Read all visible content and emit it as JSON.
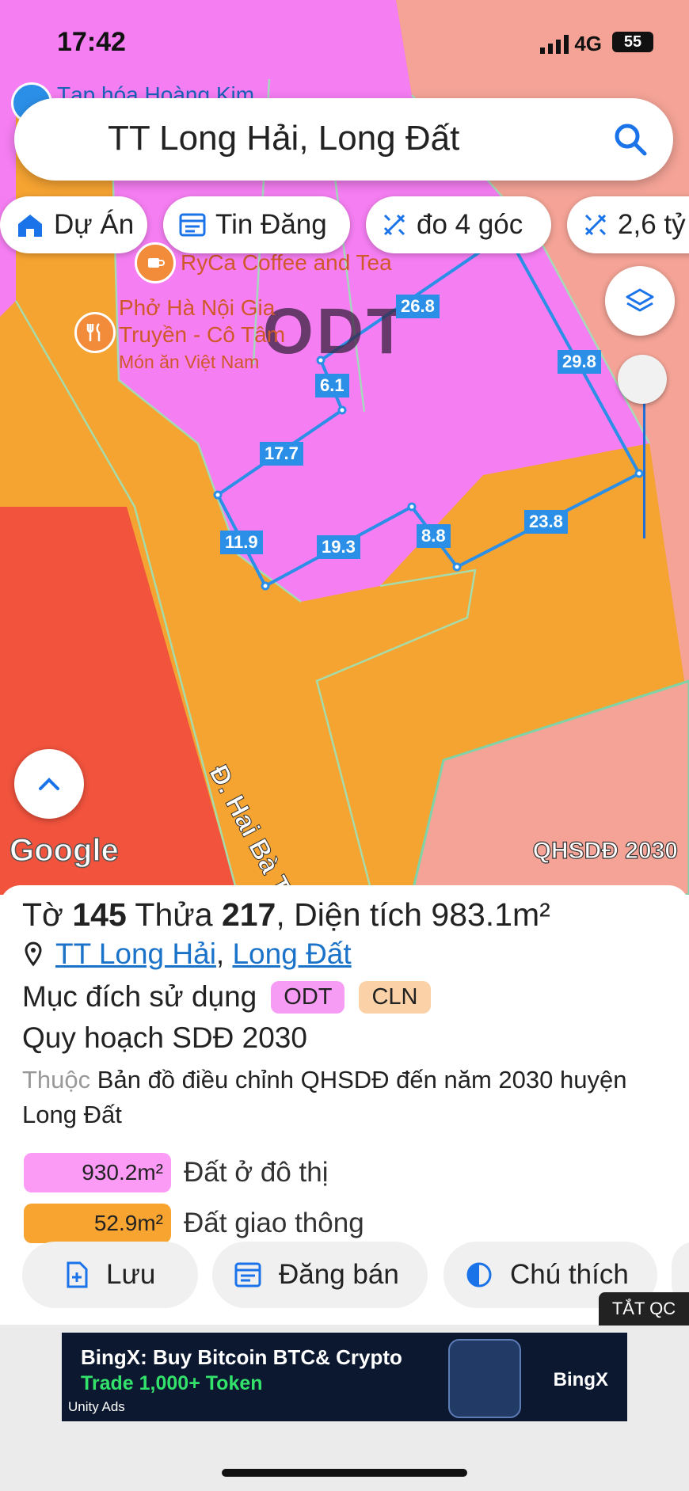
{
  "status": {
    "time": "17:42",
    "network": "4G",
    "battery": "55"
  },
  "search": {
    "query": "TT Long Hải, Long Đất"
  },
  "chips": [
    "Dự Án",
    "Tin Đăng",
    "đo 4 góc",
    "2,6 tỷ"
  ],
  "map": {
    "poi": [
      {
        "name": "Tạp hóa Hoàng Kim"
      },
      {
        "name": "RyCa Coffee and Tea"
      },
      {
        "name": "Phở Hà Nội Gia Truyền - Cô Tâm",
        "line1": "Phở Hà Nội Gia",
        "line2": "Truyền - Cô Tâm",
        "category": "Món ăn Việt Nam"
      }
    ],
    "zone_label": "ODT",
    "road_label": "Đ. Hai Bà Trưng",
    "edge_lengths": [
      "26.8",
      "29.8",
      "6.1",
      "17.7",
      "11.9",
      "19.3",
      "8.8",
      "23.8"
    ],
    "attribution": "Google",
    "layer_name": "QHSDĐ 2030"
  },
  "parcel": {
    "to_label": "Tờ",
    "to": "145",
    "thua_label": "Thửa",
    "thua": "217",
    "area_label": "Diện tích",
    "area": "983.1m²",
    "location_town": "TT Long Hải",
    "location_district": "Long Đất",
    "purpose_label": "Mục đích sử dụng",
    "purposes": [
      {
        "code": "ODT",
        "color": "#f79cf4"
      },
      {
        "code": "CLN",
        "color": "#fbd2a8"
      }
    ],
    "plan_title": "Quy hoạch SDĐ 2030",
    "belongs_label": "Thuộc",
    "belongs_text": "Bản đồ điều chỉnh QHSDĐ đến năm 2030 huyện Long Đất",
    "breakdown": [
      {
        "area": "930.2m²",
        "label": "Đất ở đô thị",
        "color": "#fb9bf5"
      },
      {
        "area": "52.9m²",
        "label": "Đất giao thông",
        "color": "#f7a530"
      }
    ]
  },
  "actions": [
    "Lưu",
    "Đăng bán",
    "Chú thích"
  ],
  "ad": {
    "close_label": "TẮT QC",
    "title": "BingX: Buy Bitcoin BTC& Crypto",
    "subtitle": "Trade 1,000+ Token",
    "brand": "BingX",
    "provider": "Unity Ads"
  },
  "colors": {
    "accent": "#1a73e8",
    "zone_odt": "#f57ef2",
    "zone_road": "#f5a331",
    "zone_red": "#f1533d",
    "zone_salmon": "#f4a396"
  }
}
